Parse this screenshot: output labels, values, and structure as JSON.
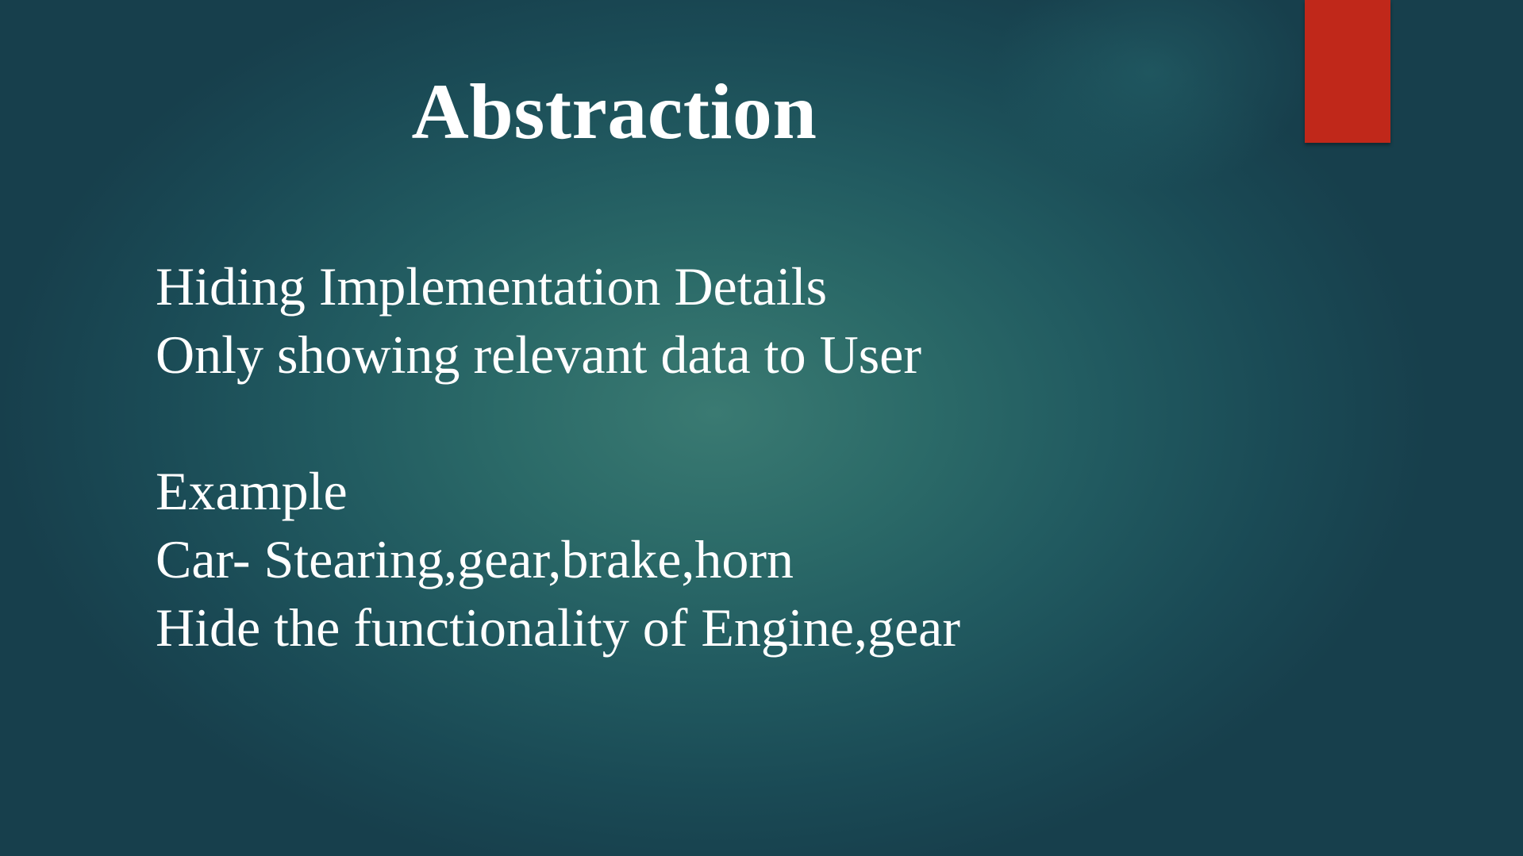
{
  "slide": {
    "title": "Abstraction",
    "lines": [
      "Hiding Implementation Details",
      "Only showing relevant data to User",
      "",
      "Example",
      "Car- Stearing,gear,brake,horn",
      "Hide the functionality of Engine,gear"
    ]
  },
  "colors": {
    "background": "#215a60",
    "accent": "#c0281a",
    "text": "#ffffff"
  }
}
